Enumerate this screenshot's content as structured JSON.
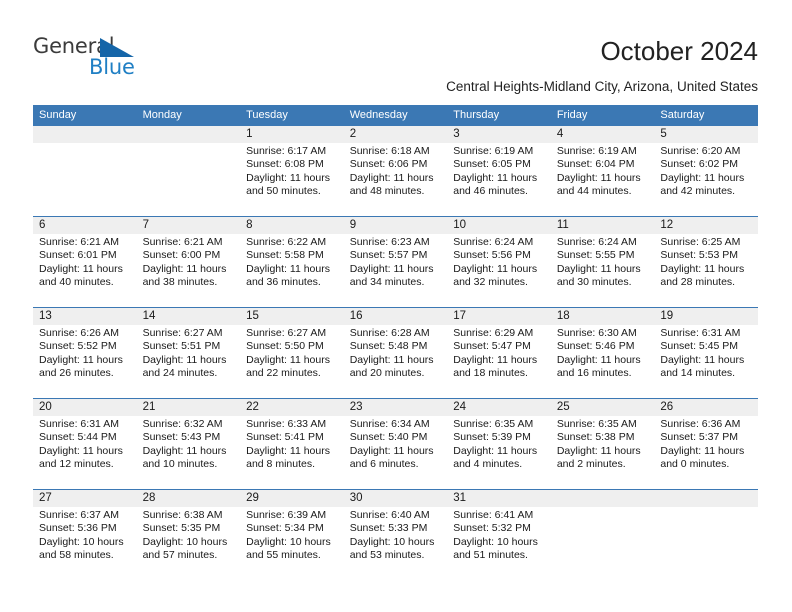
{
  "brand": {
    "name_top": "General",
    "name_bottom": "Blue",
    "triangle_color": "#1565a8",
    "blue_color": "#1f7fc4",
    "gray_color": "#3b3b3b"
  },
  "header": {
    "title": "October 2024",
    "subtitle": "Central Heights-Midland City, Arizona, United States"
  },
  "theme": {
    "header_blue": "#3b78b4",
    "daynum_band": "#efefef",
    "text": "#1a1a1a"
  },
  "weekdays": [
    "Sunday",
    "Monday",
    "Tuesday",
    "Wednesday",
    "Thursday",
    "Friday",
    "Saturday"
  ],
  "weeks": [
    [
      {
        "day": "",
        "sunrise": "",
        "sunset": "",
        "daylight_1": "",
        "daylight_2": ""
      },
      {
        "day": "",
        "sunrise": "",
        "sunset": "",
        "daylight_1": "",
        "daylight_2": ""
      },
      {
        "day": "1",
        "sunrise": "Sunrise: 6:17 AM",
        "sunset": "Sunset: 6:08 PM",
        "daylight_1": "Daylight: 11 hours",
        "daylight_2": "and 50 minutes."
      },
      {
        "day": "2",
        "sunrise": "Sunrise: 6:18 AM",
        "sunset": "Sunset: 6:06 PM",
        "daylight_1": "Daylight: 11 hours",
        "daylight_2": "and 48 minutes."
      },
      {
        "day": "3",
        "sunrise": "Sunrise: 6:19 AM",
        "sunset": "Sunset: 6:05 PM",
        "daylight_1": "Daylight: 11 hours",
        "daylight_2": "and 46 minutes."
      },
      {
        "day": "4",
        "sunrise": "Sunrise: 6:19 AM",
        "sunset": "Sunset: 6:04 PM",
        "daylight_1": "Daylight: 11 hours",
        "daylight_2": "and 44 minutes."
      },
      {
        "day": "5",
        "sunrise": "Sunrise: 6:20 AM",
        "sunset": "Sunset: 6:02 PM",
        "daylight_1": "Daylight: 11 hours",
        "daylight_2": "and 42 minutes."
      }
    ],
    [
      {
        "day": "6",
        "sunrise": "Sunrise: 6:21 AM",
        "sunset": "Sunset: 6:01 PM",
        "daylight_1": "Daylight: 11 hours",
        "daylight_2": "and 40 minutes."
      },
      {
        "day": "7",
        "sunrise": "Sunrise: 6:21 AM",
        "sunset": "Sunset: 6:00 PM",
        "daylight_1": "Daylight: 11 hours",
        "daylight_2": "and 38 minutes."
      },
      {
        "day": "8",
        "sunrise": "Sunrise: 6:22 AM",
        "sunset": "Sunset: 5:58 PM",
        "daylight_1": "Daylight: 11 hours",
        "daylight_2": "and 36 minutes."
      },
      {
        "day": "9",
        "sunrise": "Sunrise: 6:23 AM",
        "sunset": "Sunset: 5:57 PM",
        "daylight_1": "Daylight: 11 hours",
        "daylight_2": "and 34 minutes."
      },
      {
        "day": "10",
        "sunrise": "Sunrise: 6:24 AM",
        "sunset": "Sunset: 5:56 PM",
        "daylight_1": "Daylight: 11 hours",
        "daylight_2": "and 32 minutes."
      },
      {
        "day": "11",
        "sunrise": "Sunrise: 6:24 AM",
        "sunset": "Sunset: 5:55 PM",
        "daylight_1": "Daylight: 11 hours",
        "daylight_2": "and 30 minutes."
      },
      {
        "day": "12",
        "sunrise": "Sunrise: 6:25 AM",
        "sunset": "Sunset: 5:53 PM",
        "daylight_1": "Daylight: 11 hours",
        "daylight_2": "and 28 minutes."
      }
    ],
    [
      {
        "day": "13",
        "sunrise": "Sunrise: 6:26 AM",
        "sunset": "Sunset: 5:52 PM",
        "daylight_1": "Daylight: 11 hours",
        "daylight_2": "and 26 minutes."
      },
      {
        "day": "14",
        "sunrise": "Sunrise: 6:27 AM",
        "sunset": "Sunset: 5:51 PM",
        "daylight_1": "Daylight: 11 hours",
        "daylight_2": "and 24 minutes."
      },
      {
        "day": "15",
        "sunrise": "Sunrise: 6:27 AM",
        "sunset": "Sunset: 5:50 PM",
        "daylight_1": "Daylight: 11 hours",
        "daylight_2": "and 22 minutes."
      },
      {
        "day": "16",
        "sunrise": "Sunrise: 6:28 AM",
        "sunset": "Sunset: 5:48 PM",
        "daylight_1": "Daylight: 11 hours",
        "daylight_2": "and 20 minutes."
      },
      {
        "day": "17",
        "sunrise": "Sunrise: 6:29 AM",
        "sunset": "Sunset: 5:47 PM",
        "daylight_1": "Daylight: 11 hours",
        "daylight_2": "and 18 minutes."
      },
      {
        "day": "18",
        "sunrise": "Sunrise: 6:30 AM",
        "sunset": "Sunset: 5:46 PM",
        "daylight_1": "Daylight: 11 hours",
        "daylight_2": "and 16 minutes."
      },
      {
        "day": "19",
        "sunrise": "Sunrise: 6:31 AM",
        "sunset": "Sunset: 5:45 PM",
        "daylight_1": "Daylight: 11 hours",
        "daylight_2": "and 14 minutes."
      }
    ],
    [
      {
        "day": "20",
        "sunrise": "Sunrise: 6:31 AM",
        "sunset": "Sunset: 5:44 PM",
        "daylight_1": "Daylight: 11 hours",
        "daylight_2": "and 12 minutes."
      },
      {
        "day": "21",
        "sunrise": "Sunrise: 6:32 AM",
        "sunset": "Sunset: 5:43 PM",
        "daylight_1": "Daylight: 11 hours",
        "daylight_2": "and 10 minutes."
      },
      {
        "day": "22",
        "sunrise": "Sunrise: 6:33 AM",
        "sunset": "Sunset: 5:41 PM",
        "daylight_1": "Daylight: 11 hours",
        "daylight_2": "and 8 minutes."
      },
      {
        "day": "23",
        "sunrise": "Sunrise: 6:34 AM",
        "sunset": "Sunset: 5:40 PM",
        "daylight_1": "Daylight: 11 hours",
        "daylight_2": "and 6 minutes."
      },
      {
        "day": "24",
        "sunrise": "Sunrise: 6:35 AM",
        "sunset": "Sunset: 5:39 PM",
        "daylight_1": "Daylight: 11 hours",
        "daylight_2": "and 4 minutes."
      },
      {
        "day": "25",
        "sunrise": "Sunrise: 6:35 AM",
        "sunset": "Sunset: 5:38 PM",
        "daylight_1": "Daylight: 11 hours",
        "daylight_2": "and 2 minutes."
      },
      {
        "day": "26",
        "sunrise": "Sunrise: 6:36 AM",
        "sunset": "Sunset: 5:37 PM",
        "daylight_1": "Daylight: 11 hours",
        "daylight_2": "and 0 minutes."
      }
    ],
    [
      {
        "day": "27",
        "sunrise": "Sunrise: 6:37 AM",
        "sunset": "Sunset: 5:36 PM",
        "daylight_1": "Daylight: 10 hours",
        "daylight_2": "and 58 minutes."
      },
      {
        "day": "28",
        "sunrise": "Sunrise: 6:38 AM",
        "sunset": "Sunset: 5:35 PM",
        "daylight_1": "Daylight: 10 hours",
        "daylight_2": "and 57 minutes."
      },
      {
        "day": "29",
        "sunrise": "Sunrise: 6:39 AM",
        "sunset": "Sunset: 5:34 PM",
        "daylight_1": "Daylight: 10 hours",
        "daylight_2": "and 55 minutes."
      },
      {
        "day": "30",
        "sunrise": "Sunrise: 6:40 AM",
        "sunset": "Sunset: 5:33 PM",
        "daylight_1": "Daylight: 10 hours",
        "daylight_2": "and 53 minutes."
      },
      {
        "day": "31",
        "sunrise": "Sunrise: 6:41 AM",
        "sunset": "Sunset: 5:32 PM",
        "daylight_1": "Daylight: 10 hours",
        "daylight_2": "and 51 minutes."
      },
      {
        "day": "",
        "sunrise": "",
        "sunset": "",
        "daylight_1": "",
        "daylight_2": ""
      },
      {
        "day": "",
        "sunrise": "",
        "sunset": "",
        "daylight_1": "",
        "daylight_2": ""
      }
    ]
  ]
}
